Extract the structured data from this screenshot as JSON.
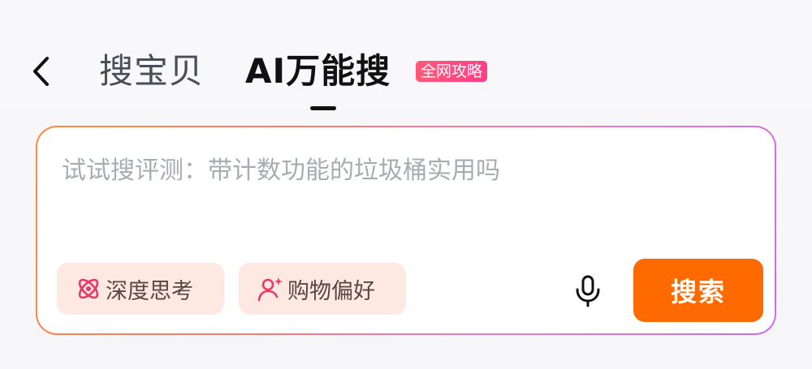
{
  "header": {
    "back_icon": "chevron-left-icon",
    "tabs": [
      {
        "label": "搜宝贝",
        "active": false
      },
      {
        "label": "AI万能搜",
        "active": true
      }
    ],
    "badge": "全网攻略"
  },
  "search": {
    "placeholder": "试试搜评测：带计数功能的垃圾桶实用吗",
    "value": "",
    "chips": [
      {
        "label": "深度思考",
        "icon": "atom-icon"
      },
      {
        "label": "购物偏好",
        "icon": "user-sparkle-icon"
      }
    ],
    "mic_icon": "microphone-icon",
    "submit_label": "搜索"
  },
  "colors": {
    "accent": "#ff6a00",
    "badge": "#ff4b80",
    "chip_bg": "#fde9e2",
    "chip_icon": "#e8396a",
    "placeholder": "#a9abb3"
  }
}
